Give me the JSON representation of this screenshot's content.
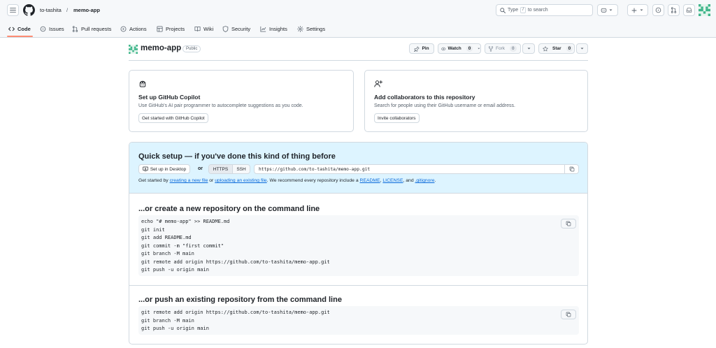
{
  "header": {
    "owner": "to-tashita",
    "separator": "/",
    "repo": "memo-app",
    "search_prefix": "Type",
    "search_key": "/",
    "search_suffix": "to search",
    "icons": [
      "hamburger-icon",
      "github-logo-icon",
      "search-icon",
      "copilot-icon",
      "chevron-down-icon",
      "plus-icon",
      "issues-icon",
      "pull-request-icon",
      "inbox-icon",
      "avatar"
    ]
  },
  "tabs": [
    {
      "label": "Code",
      "icon": "code-icon"
    },
    {
      "label": "Issues",
      "icon": "issue-opened-icon"
    },
    {
      "label": "Pull requests",
      "icon": "git-pull-request-icon"
    },
    {
      "label": "Actions",
      "icon": "play-icon"
    },
    {
      "label": "Projects",
      "icon": "table-icon"
    },
    {
      "label": "Wiki",
      "icon": "book-icon"
    },
    {
      "label": "Security",
      "icon": "shield-icon"
    },
    {
      "label": "Insights",
      "icon": "graph-icon"
    },
    {
      "label": "Settings",
      "icon": "gear-icon"
    }
  ],
  "repo_header": {
    "name": "memo-app",
    "visibility": "Public",
    "pin_label": "Pin",
    "watch_label": "Watch",
    "watch_count": "0",
    "fork_label": "Fork",
    "fork_count": "0",
    "star_label": "Star",
    "star_count": "0"
  },
  "copilot_card": {
    "title": "Set up GitHub Copilot",
    "description": "Use GitHub's AI pair programmer to autocomplete suggestions as you code.",
    "button": "Get started with GitHub Copilot"
  },
  "collab_card": {
    "title": "Add collaborators to this repository",
    "description": "Search for people using their GitHub username or email address.",
    "button": "Invite collaborators"
  },
  "quick_setup": {
    "title": "Quick setup — if you've done this kind of thing before",
    "desktop_button": "Set up in Desktop",
    "or_label": "or",
    "https_label": "HTTPS",
    "ssh_label": "SSH",
    "clone_url": "https://github.com/to-tashita/memo-app.git",
    "info_prefix": "Get started by",
    "link_new_file": "creating a new file",
    "info_or": "or",
    "link_upload": "uploading an existing file",
    "info_middle": ". We recommend every repository include a",
    "link_readme": "README",
    "comma": ",",
    "link_license": "LICENSE",
    "and_label": ", and",
    "link_gitignore": ".gitignore",
    "period": "."
  },
  "create_section": {
    "title": "...or create a new repository on the command line",
    "lines": [
      "echo \"# memo-app\" >> README.md",
      "git init",
      "git add README.md",
      "git commit -m \"first commit\"",
      "git branch -M main",
      "git remote add origin https://github.com/to-tashita/memo-app.git",
      "git push -u origin main"
    ]
  },
  "push_section": {
    "title": "...or push an existing repository from the command line",
    "lines": [
      "git remote add origin https://github.com/to-tashita/memo-app.git",
      "git branch -M main",
      "git push -u origin main"
    ]
  },
  "colors": {
    "accent_blue": "#0969da",
    "tab_underline": "#fd8c73",
    "quick_setup_bg": "#ddf4ff",
    "border": "#d1d9e0",
    "identicon": "#3fb68b"
  }
}
